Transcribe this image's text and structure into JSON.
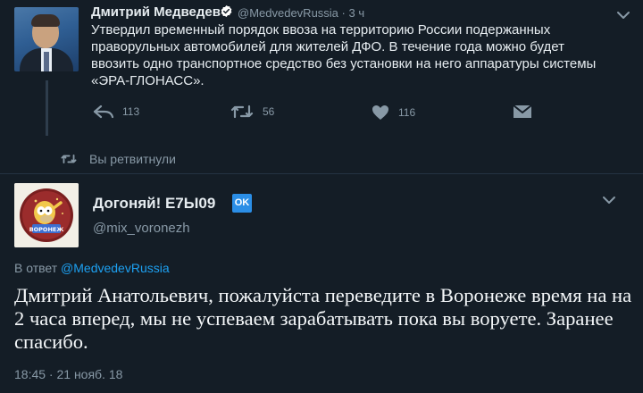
{
  "top_tweet": {
    "author_name": "Дмитрий Медведев",
    "handle": "@MedvedevRussia",
    "time": "3 ч",
    "text": "Утвердил временный порядок ввоза на территорию России подержанных праворульных автомобилей для жителей ДФО. В течение года можно будет ввозить одно транспортное средство без установки на него аппаратуры системы «ЭРА-ГЛОНАСС».",
    "actions": {
      "reply_count": "113",
      "retweet_count": "56",
      "like_count": "116"
    }
  },
  "retweet_notice": {
    "label": "Вы ретвитнули"
  },
  "main_tweet": {
    "author_name": "Догоняй! Е7Ы09",
    "emoji": "OK",
    "handle": "@mix_voronezh",
    "reply_prefix": "В ответ",
    "reply_mention": "@MedvedevRussia",
    "text": "Дмитрий Анатольевич, пожалуйста переведите в Воронеже время на на 2 часа вперед, мы не успеваем зарабатывать пока вы воруете. Заранее спасибо.",
    "timestamp": "18:45 · 21 нояб. 18",
    "avatar_text": "ВОРОНЕЖ"
  },
  "colors": {
    "background": "#141d26",
    "text": "#e6ecf0",
    "secondary": "#8899a6",
    "link": "#1da1f2",
    "verified": "#ffffff"
  },
  "icons": [
    "verified-badge-icon",
    "chevron-down-icon",
    "reply-icon",
    "retweet-icon",
    "heart-icon",
    "envelope-icon"
  ]
}
